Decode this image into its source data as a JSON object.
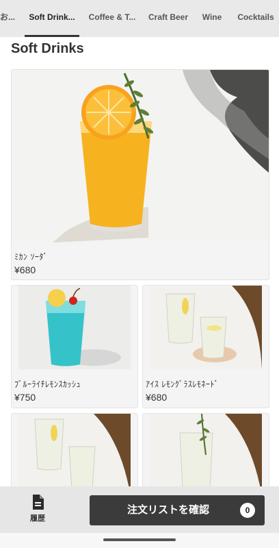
{
  "tabs": [
    {
      "label": "お..."
    },
    {
      "label": "Soft Drink..."
    },
    {
      "label": "Coffee & T..."
    },
    {
      "label": "Craft Beer"
    },
    {
      "label": "Wine"
    },
    {
      "label": "Cocktails"
    }
  ],
  "section_title": "Soft Drinks",
  "items": [
    {
      "name": "ﾐｶﾝ ｿｰﾀﾞ",
      "price": "¥680"
    },
    {
      "name": "ﾌﾞﾙｰﾗｲﾁﾚﾓﾝｽｶｯｼｭ",
      "price": "¥750"
    },
    {
      "name": "ｱｲｽ ﾚﾓﾝｸﾞﾗｽﾚﾓﾈｰﾄﾞ",
      "price": "¥680"
    },
    {
      "name": "",
      "price": ""
    },
    {
      "name": "",
      "price": ""
    }
  ],
  "bottom": {
    "history_label": "履歴",
    "confirm_label": "注文リストを確認",
    "cart_count": "0"
  },
  "colors": {
    "tabbar_bg": "#e9e9e9",
    "button_bg": "#3b3b3b",
    "orange_drink": "#f5a623",
    "blue_drink": "#2ec4c8"
  }
}
